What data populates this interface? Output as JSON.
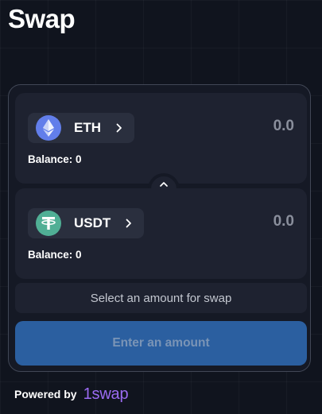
{
  "page": {
    "title": "Swap"
  },
  "from": {
    "token_symbol": "ETH",
    "token_icon": "eth-icon",
    "amount": "0.0",
    "balance_label": "Balance: 0"
  },
  "to": {
    "token_symbol": "USDT",
    "token_icon": "tether-icon",
    "amount": "0.0",
    "balance_label": "Balance: 0"
  },
  "status": {
    "message": "Select an amount for swap"
  },
  "actions": {
    "submit_label": "Enter an amount"
  },
  "footer": {
    "powered_by_label": "Powered by",
    "brand": "1swap"
  },
  "colors": {
    "background": "#10141e",
    "eth": "#627eea",
    "tether": "#50af95",
    "primary": "#2b5fa0",
    "brand": "#9b6bf2"
  }
}
